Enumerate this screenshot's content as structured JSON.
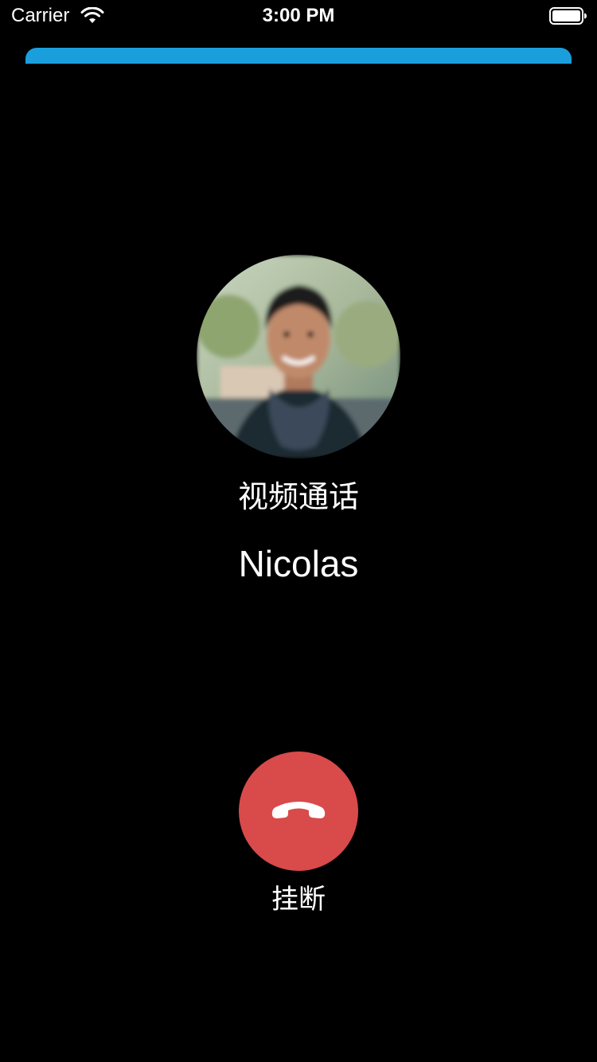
{
  "status_bar": {
    "carrier": "Carrier",
    "time": "3:00 PM",
    "wifi_icon": "wifi-icon",
    "battery_icon": "battery-icon"
  },
  "call": {
    "type_label": "视频通话",
    "caller_name": "Nicolas",
    "avatar_icon": "person-avatar"
  },
  "actions": {
    "hangup_label": "挂断",
    "hangup_icon": "phone-hangup-icon"
  },
  "colors": {
    "background": "#000000",
    "banner": "#1a9fdc",
    "hangup": "#d94a4a",
    "text": "#ffffff"
  }
}
